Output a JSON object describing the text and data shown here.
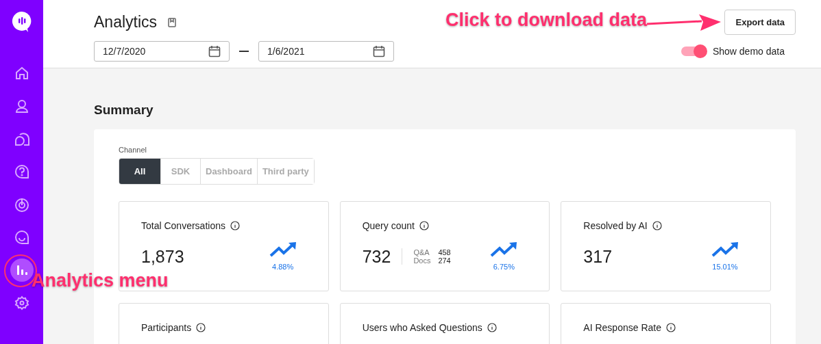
{
  "sidebar": {
    "items": [
      {
        "kind": "home",
        "selected": false
      },
      {
        "kind": "user",
        "selected": false
      },
      {
        "kind": "chat",
        "selected": false
      },
      {
        "kind": "help",
        "selected": false
      },
      {
        "kind": "target",
        "selected": false
      },
      {
        "kind": "smile",
        "selected": false
      },
      {
        "kind": "analytics",
        "selected": true
      },
      {
        "kind": "settings",
        "selected": false
      }
    ]
  },
  "header": {
    "title": "Analytics",
    "export_button": "Export data",
    "start_date": "12/7/2020",
    "end_date": "1/6/2021",
    "demo_toggle": {
      "label": "Show demo data",
      "on": true
    }
  },
  "summary": {
    "title": "Summary",
    "channel_label": "Channel",
    "channels": [
      {
        "label": "All",
        "selected": true
      },
      {
        "label": "SDK",
        "selected": false
      },
      {
        "label": "Dashboard",
        "selected": false
      },
      {
        "label": "Third party",
        "selected": false
      }
    ],
    "cards": [
      {
        "title": "Total Conversations",
        "value": "1,873",
        "change": "4.88%"
      },
      {
        "title": "Query count",
        "value": "732",
        "breakdown": [
          {
            "label": "Q&A",
            "value": "458"
          },
          {
            "label": "Docs",
            "value": "274"
          }
        ],
        "change": "6.75%"
      },
      {
        "title": "Resolved by AI",
        "value": "317",
        "change": "15.01%"
      },
      {
        "title": "Participants"
      },
      {
        "title": "Users who Asked Questions"
      },
      {
        "title": "AI Response Rate"
      }
    ]
  },
  "annotations": [
    {
      "kind": "arrow",
      "text": "Click to download data"
    },
    {
      "kind": "circle",
      "text": "Analytics menu"
    }
  ]
}
